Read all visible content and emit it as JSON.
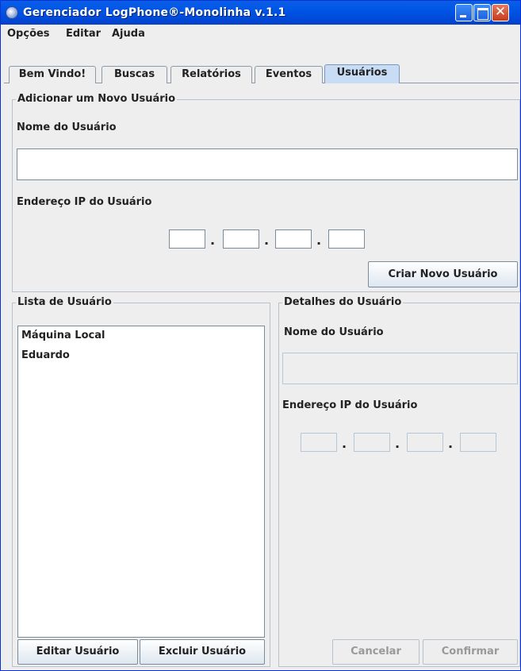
{
  "window": {
    "title": "Gerenciador LogPhone®-Monolinha v.1.1",
    "close_glyph": "✕"
  },
  "menu": [
    "Opções",
    "Editar",
    "Ajuda"
  ],
  "tabs": [
    {
      "label": "Bem Vindo!",
      "active": false
    },
    {
      "label": "Buscas",
      "active": false
    },
    {
      "label": "Relatórios",
      "active": false
    },
    {
      "label": "Eventos",
      "active": false
    },
    {
      "label": "Usuários",
      "active": true
    }
  ],
  "add_user": {
    "group_title": "Adicionar um Novo Usuário",
    "name_label": "Nome do Usuário",
    "name_value": "",
    "ip_label": "Endereço IP do Usuário",
    "ip_octets": [
      "",
      "",
      "",
      ""
    ],
    "ip_separator": ".",
    "create_button": "Criar Novo Usuário"
  },
  "user_list": {
    "group_title": "Lista de Usuário",
    "items": [
      "Máquina Local",
      "Eduardo"
    ],
    "edit_button": "Editar Usuário",
    "delete_button": "Excluir Usuário"
  },
  "user_details": {
    "group_title": "Detalhes do Usuário",
    "name_label": "Nome do Usuário",
    "name_value": "",
    "ip_label": "Endereço IP do Usuário",
    "ip_octets": [
      "",
      "",
      "",
      ""
    ],
    "ip_separator": ".",
    "cancel_button": "Cancelar",
    "confirm_button": "Confirmar"
  }
}
